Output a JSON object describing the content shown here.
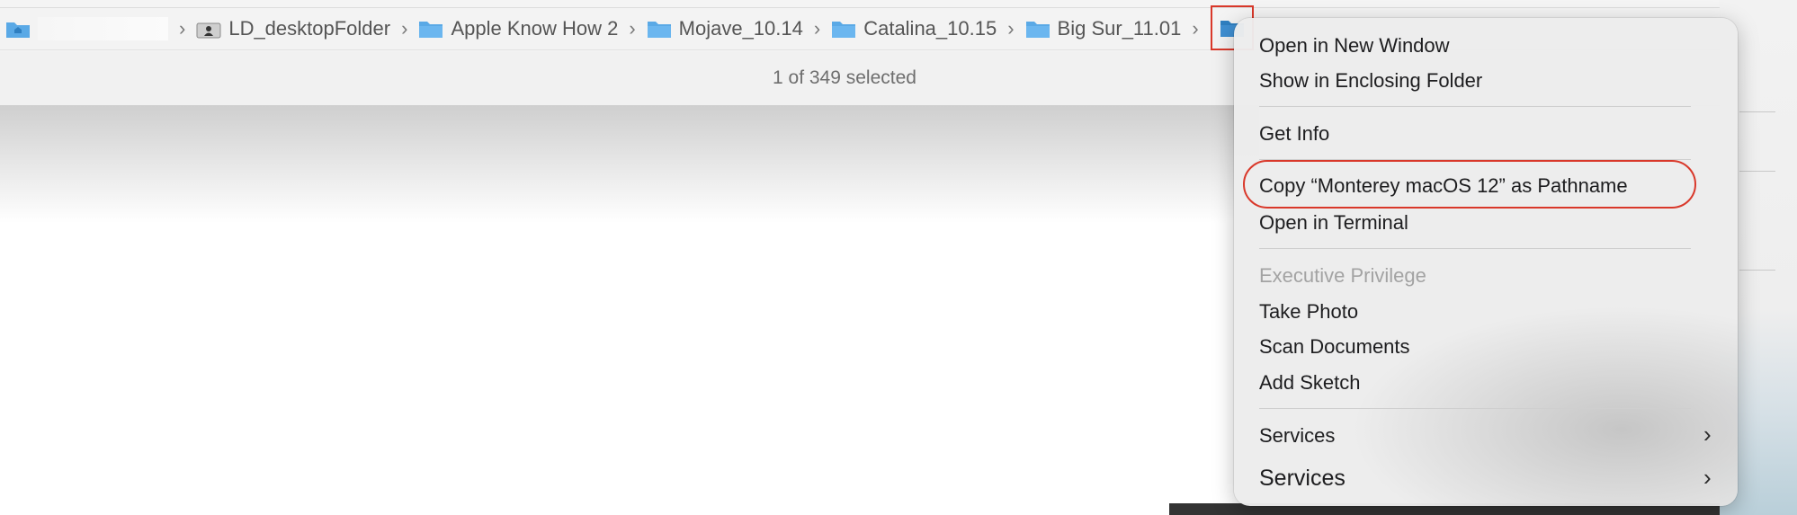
{
  "path_bar": {
    "root_name_hidden": "",
    "crumbs": [
      "LD_desktopFolder",
      "Apple Know How 2",
      "Mojave_10.14",
      "Catalina_10.15",
      "Big Sur_11.01"
    ],
    "separator": "›"
  },
  "status_bar": {
    "text": "1 of 349 selected"
  },
  "context_menu": {
    "items": [
      "Open in New Window",
      "Show in Enclosing Folder",
      "Get Info",
      "Copy “Monterey macOS 12” as Pathname",
      "Open in Terminal",
      "Executive Privilege",
      "Take Photo",
      "Scan Documents",
      "Add Sketch",
      "Services",
      "Services"
    ],
    "submenu_chevron": "›"
  },
  "colors": {
    "highlight": "#d9382a",
    "folder_blue": "#5aa9e6",
    "text": "#1d1d1f"
  },
  "icons": [
    "home-folder-icon",
    "user-folder-icon",
    "folder-icon",
    "chevron-right-icon"
  ]
}
